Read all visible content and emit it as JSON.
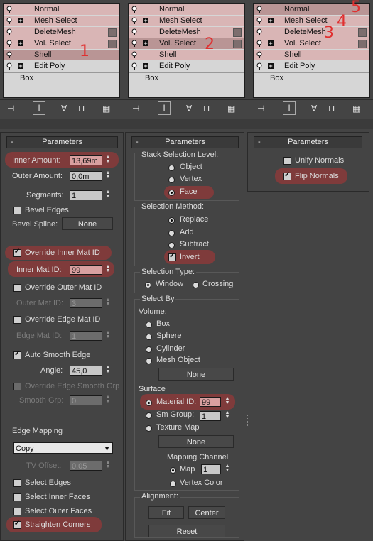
{
  "stacks": [
    {
      "rows": [
        "Normal",
        "Mesh Select",
        "DeleteMesh",
        "Vol. Select",
        "Shell",
        "Edit Poly",
        "Box"
      ]
    },
    {
      "rows": [
        "Normal",
        "Mesh Select",
        "DeleteMesh",
        "Vol. Select",
        "Shell",
        "Edit Poly",
        "Box"
      ]
    },
    {
      "rows": [
        "Normal",
        "Mesh Select",
        "DeleteMesh",
        "Vol. Select",
        "Shell",
        "Edit Poly",
        "Box"
      ]
    }
  ],
  "annotations": {
    "a1": "1",
    "a2": "2",
    "a3": "3",
    "a4": "4",
    "a5": "5"
  },
  "panel_title": "Parameters",
  "panel_minus": "-",
  "shell": {
    "inner_amount_label": "Inner Amount:",
    "inner_amount": "13,69m",
    "outer_amount_label": "Outer Amount:",
    "outer_amount": "0,0m",
    "segments_label": "Segments:",
    "segments": "1",
    "bevel_edges": "Bevel Edges",
    "bevel_spline_label": "Bevel Spline:",
    "bevel_spline_btn": "None",
    "override_inner": "Override Inner Mat ID",
    "inner_mat_label": "Inner Mat ID:",
    "inner_mat": "99",
    "override_outer": "Override Outer Mat ID",
    "outer_mat_label": "Outer Mat ID:",
    "outer_mat": "3",
    "override_edge": "Override Edge Mat ID",
    "edge_mat_label": "Edge Mat ID:",
    "edge_mat": "1",
    "auto_smooth": "Auto Smooth Edge",
    "angle_label": "Angle:",
    "angle": "45,0",
    "override_edge_smooth": "Override Edge Smooth Grp",
    "smooth_grp_label": "Smooth Grp:",
    "smooth_grp": "0",
    "edge_mapping_label": "Edge Mapping",
    "edge_mapping": "Copy",
    "tv_offset_label": "TV Offset:",
    "tv_offset": "0,05",
    "select_edges": "Select Edges",
    "select_inner": "Select Inner Faces",
    "select_outer": "Select Outer Faces",
    "straighten": "Straighten Corners"
  },
  "volsel": {
    "stack_level": "Stack Selection Level:",
    "object": "Object",
    "vertex": "Vertex",
    "face": "Face",
    "sel_method": "Selection Method:",
    "replace": "Replace",
    "add": "Add",
    "subtract": "Subtract",
    "invert": "Invert",
    "sel_type": "Selection Type:",
    "window": "Window",
    "crossing": "Crossing",
    "select_by": "Select By",
    "volume": "Volume:",
    "box": "Box",
    "sphere": "Sphere",
    "cylinder": "Cylinder",
    "mesh_object": "Mesh Object",
    "none1": "None",
    "surface": "Surface",
    "material_id_label": "Material ID:",
    "material_id": "99",
    "sm_group_label": "Sm Group:",
    "sm_group": "1",
    "texture_map": "Texture Map",
    "none2": "None",
    "mapping_channel": "Mapping Channel",
    "map_label": "Map",
    "map": "1",
    "vertex_color": "Vertex Color",
    "alignment": "Alignment:",
    "fit": "Fit",
    "center": "Center",
    "reset": "Reset"
  },
  "normal": {
    "unify": "Unify Normals",
    "flip": "Flip Normals"
  }
}
